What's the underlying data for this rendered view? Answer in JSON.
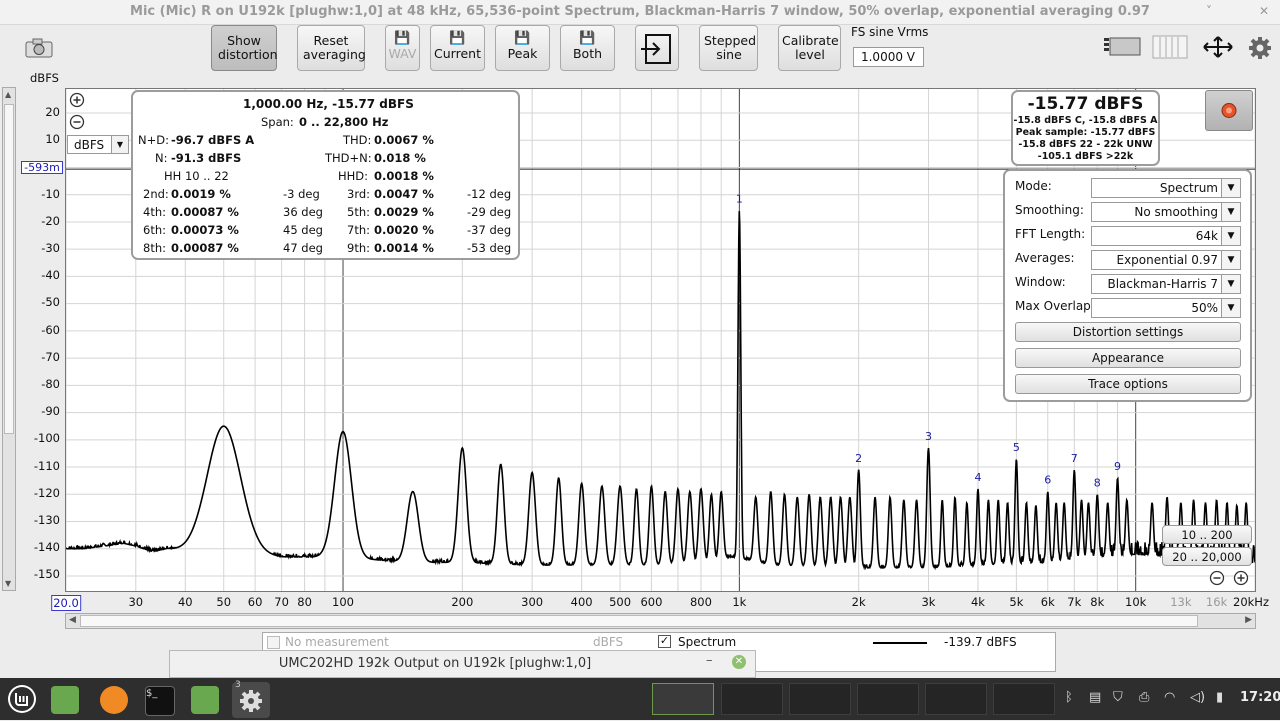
{
  "window": {
    "title": "Mic (Mic) R on U192k [plughw:1,0] at 48 kHz, 65,536-point Spectrum, Blackman-Harris 7 window, 50% overlap, exponential averaging 0.97",
    "minimize": "˅",
    "close": "✕"
  },
  "toolbar": {
    "show_distortion": "Show distortion",
    "reset_averaging": "Reset averaging",
    "wav": "WAV",
    "current": "Current",
    "peak": "Peak",
    "both": "Both",
    "stepped_sine": "Stepped sine",
    "calibrate_level": "Calibrate level",
    "fs_label": "FS sine Vrms",
    "fs_value": "1.0000 V"
  },
  "plot": {
    "y_unit": "dBFS",
    "y_offset_marker": "-593m",
    "unit_select": "dBFS",
    "y_ticks": [
      "20",
      "10",
      "0",
      "-10",
      "-20",
      "-30",
      "-40",
      "-50",
      "-60",
      "-70",
      "-80",
      "-90",
      "-100",
      "-110",
      "-120",
      "-130",
      "-140",
      "-150"
    ],
    "x_ticks": [
      {
        "label": "20.0",
        "v": 20
      },
      {
        "label": "30",
        "v": 30
      },
      {
        "label": "40",
        "v": 40
      },
      {
        "label": "50",
        "v": 50
      },
      {
        "label": "60",
        "v": 60
      },
      {
        "label": "70",
        "v": 70
      },
      {
        "label": "80",
        "v": 80
      },
      {
        "label": "100",
        "v": 100
      },
      {
        "label": "200",
        "v": 200
      },
      {
        "label": "300",
        "v": 300
      },
      {
        "label": "400",
        "v": 400
      },
      {
        "label": "500",
        "v": 500
      },
      {
        "label": "600",
        "v": 600
      },
      {
        "label": "800",
        "v": 800
      },
      {
        "label": "1k",
        "v": 1000
      },
      {
        "label": "2k",
        "v": 2000
      },
      {
        "label": "3k",
        "v": 3000
      },
      {
        "label": "4k",
        "v": 4000
      },
      {
        "label": "5k",
        "v": 5000
      },
      {
        "label": "6k",
        "v": 6000
      },
      {
        "label": "7k",
        "v": 7000
      },
      {
        "label": "8k",
        "v": 8000
      },
      {
        "label": "10k",
        "v": 10000
      },
      {
        "label": "13k",
        "v": 13000
      },
      {
        "label": "16k",
        "v": 16000
      },
      {
        "label": "20kHz",
        "v": 20000
      }
    ],
    "range_btn_1": "10 .. 200",
    "range_btn_2": "20 .. 20,000"
  },
  "distortion": {
    "header": "1,000.00 Hz, -15.77 dBFS",
    "span_label": "Span:",
    "span_value": "0 .. 22,800 Hz",
    "nd_label": "N+D:",
    "nd_value": "-96.7 dBFS A",
    "n_label": "N:",
    "n_value": "-91.3 dBFS",
    "thd_label": "THD:",
    "thd_value": "0.0067 %",
    "thdn_label": "THD+N:",
    "thdn_value": "0.018 %",
    "hh_label": "HH 10 .. 22",
    "hhd_label": "HHD:",
    "hhd_value": "0.0018 %",
    "harmonics": [
      {
        "l1": "2nd:",
        "v1": "0.0019 %",
        "d1": "-3 deg",
        "l2": "3rd:",
        "v2": "0.0047 %",
        "d2": "-12 deg"
      },
      {
        "l1": "4th:",
        "v1": "0.00087 %",
        "d1": "36 deg",
        "l2": "5th:",
        "v2": "0.0029 %",
        "d2": "-29 deg"
      },
      {
        "l1": "6th:",
        "v1": "0.00073 %",
        "d1": "45 deg",
        "l2": "7th:",
        "v2": "0.0020 %",
        "d2": "-37 deg"
      },
      {
        "l1": "8th:",
        "v1": "0.00087 %",
        "d1": "47 deg",
        "l2": "9th:",
        "v2": "0.0014 %",
        "d2": "-53 deg"
      }
    ]
  },
  "level_meter": {
    "main": "-15.77 dBFS",
    "lines": [
      "-15.8 dBFS C, -15.8 dBFS A",
      "Peak sample: -15.77 dBFS",
      "-15.8 dBFS 22 - 22k UNW",
      "-105.1 dBFS >22k"
    ]
  },
  "settings": {
    "rows": [
      {
        "label": "Mode:",
        "value": "Spectrum"
      },
      {
        "label": "Smoothing:",
        "value": "No  smoothing"
      },
      {
        "label": "FFT Length:",
        "value": "64k"
      },
      {
        "label": "Averages:",
        "value": "Exponential 0.97"
      },
      {
        "label": "Window:",
        "value": "Blackman-Harris 7"
      },
      {
        "label": "Max Overlap:",
        "value": "50%"
      }
    ],
    "buttons": [
      "Distortion settings",
      "Appearance",
      "Trace options"
    ]
  },
  "legend": {
    "no_measurement": "No measurement",
    "unit": "dBFS",
    "spectrum": "Spectrum",
    "spectrum_value": "-139.7 dBFS"
  },
  "subwindow": {
    "title": "UMC202HD 192k Output on U192k [plughw:1,0]",
    "minimize": "–"
  },
  "taskbar": {
    "clock": "17:20",
    "badge": "3"
  },
  "colors": {
    "trace": "#000000",
    "harmonic_label": "#1a1aa0",
    "grid": "#d4d4d4",
    "record": "#e5532c"
  },
  "chart_data": {
    "type": "line",
    "title": "",
    "xlabel": "",
    "ylabel": "dBFS",
    "xscale": "log",
    "xlim": [
      20,
      20000
    ],
    "ylim": [
      -155,
      25
    ],
    "series": [
      {
        "name": "Spectrum",
        "noise_floor": [
          [
            20,
            -140
          ],
          [
            22,
            -140
          ],
          [
            25,
            -139
          ],
          [
            28,
            -138
          ],
          [
            30,
            -139
          ],
          [
            33,
            -141
          ],
          [
            36,
            -140
          ],
          [
            40,
            -141
          ],
          [
            45,
            -142
          ],
          [
            48,
            -142
          ],
          [
            55,
            -142
          ],
          [
            60,
            -142
          ],
          [
            70,
            -143
          ],
          [
            80,
            -143
          ],
          [
            90,
            -143
          ],
          [
            120,
            -144
          ],
          [
            150,
            -145
          ],
          [
            200,
            -145
          ],
          [
            300,
            -146
          ],
          [
            400,
            -146
          ],
          [
            600,
            -146
          ],
          [
            800,
            -145
          ],
          [
            950,
            -143
          ],
          [
            1050,
            -144
          ],
          [
            1200,
            -146
          ],
          [
            2000,
            -147
          ],
          [
            3000,
            -147
          ],
          [
            4000,
            -146
          ],
          [
            6000,
            -145
          ],
          [
            8000,
            -143
          ],
          [
            10000,
            -142
          ],
          [
            13000,
            -143
          ],
          [
            16000,
            -144
          ],
          [
            20000,
            -145
          ]
        ],
        "peaks": [
          [
            50,
            -95,
            0.06
          ],
          [
            100,
            -97,
            0.03
          ],
          [
            150,
            -119,
            0.02
          ],
          [
            200,
            -103,
            0.015
          ],
          [
            250,
            -109,
            0.012
          ],
          [
            300,
            -112,
            0.012
          ],
          [
            350,
            -114,
            0.01
          ],
          [
            400,
            -116,
            0.01
          ],
          [
            450,
            -117,
            0.01
          ],
          [
            500,
            -117,
            0.01
          ],
          [
            550,
            -118,
            0.008
          ],
          [
            600,
            -117,
            0.008
          ],
          [
            650,
            -119,
            0.008
          ],
          [
            700,
            -118,
            0.008
          ],
          [
            750,
            -119,
            0.008
          ],
          [
            800,
            -118,
            0.008
          ],
          [
            850,
            -120,
            0.007
          ],
          [
            900,
            -119,
            0.007
          ],
          [
            1000,
            -15.77,
            0.005
          ],
          [
            1100,
            -121,
            0.007
          ],
          [
            1200,
            -119,
            0.007
          ],
          [
            1300,
            -120,
            0.007
          ],
          [
            1400,
            -121,
            0.007
          ],
          [
            1500,
            -120,
            0.007
          ],
          [
            1600,
            -121,
            0.007
          ],
          [
            1700,
            -121,
            0.007
          ],
          [
            1800,
            -121,
            0.007
          ],
          [
            1900,
            -121,
            0.007
          ],
          [
            2000,
            -111,
            0.006
          ],
          [
            2200,
            -121,
            0.006
          ],
          [
            2400,
            -121,
            0.006
          ],
          [
            2600,
            -122,
            0.006
          ],
          [
            2800,
            -122,
            0.006
          ],
          [
            3000,
            -103,
            0.006
          ],
          [
            3250,
            -122,
            0.005
          ],
          [
            3500,
            -121,
            0.005
          ],
          [
            3750,
            -123,
            0.005
          ],
          [
            4000,
            -118,
            0.005
          ],
          [
            4250,
            -122,
            0.005
          ],
          [
            4500,
            -122,
            0.005
          ],
          [
            4750,
            -123,
            0.005
          ],
          [
            5000,
            -107,
            0.005
          ],
          [
            5300,
            -123,
            0.005
          ],
          [
            5600,
            -124,
            0.005
          ],
          [
            6000,
            -119,
            0.005
          ],
          [
            6300,
            -123,
            0.005
          ],
          [
            6600,
            -123,
            0.005
          ],
          [
            7000,
            -111,
            0.005
          ],
          [
            7300,
            -122,
            0.005
          ],
          [
            7600,
            -123,
            0.005
          ],
          [
            8000,
            -120,
            0.005
          ],
          [
            8500,
            -123,
            0.005
          ],
          [
            9000,
            -114,
            0.005
          ],
          [
            9500,
            -122,
            0.005
          ],
          [
            11000,
            -123,
            0.005
          ],
          [
            12000,
            -121,
            0.005
          ],
          [
            13000,
            -123,
            0.005
          ],
          [
            14000,
            -122,
            0.005
          ],
          [
            15000,
            -123,
            0.005
          ],
          [
            16000,
            -122,
            0.005
          ],
          [
            17000,
            -123,
            0.005
          ],
          [
            18000,
            -124,
            0.005
          ],
          [
            19000,
            -123,
            0.005
          ]
        ]
      }
    ],
    "annotations": [
      {
        "text": "1",
        "x": 1000,
        "y": -15.77
      },
      {
        "text": "2",
        "x": 2000,
        "y": -111
      },
      {
        "text": "3",
        "x": 3000,
        "y": -103
      },
      {
        "text": "4",
        "x": 4000,
        "y": -118
      },
      {
        "text": "5",
        "x": 5000,
        "y": -107
      },
      {
        "text": "6",
        "x": 6000,
        "y": -119
      },
      {
        "text": "7",
        "x": 7000,
        "y": -111
      },
      {
        "text": "8",
        "x": 8000,
        "y": -120
      },
      {
        "text": "9",
        "x": 9000,
        "y": -114
      }
    ]
  }
}
